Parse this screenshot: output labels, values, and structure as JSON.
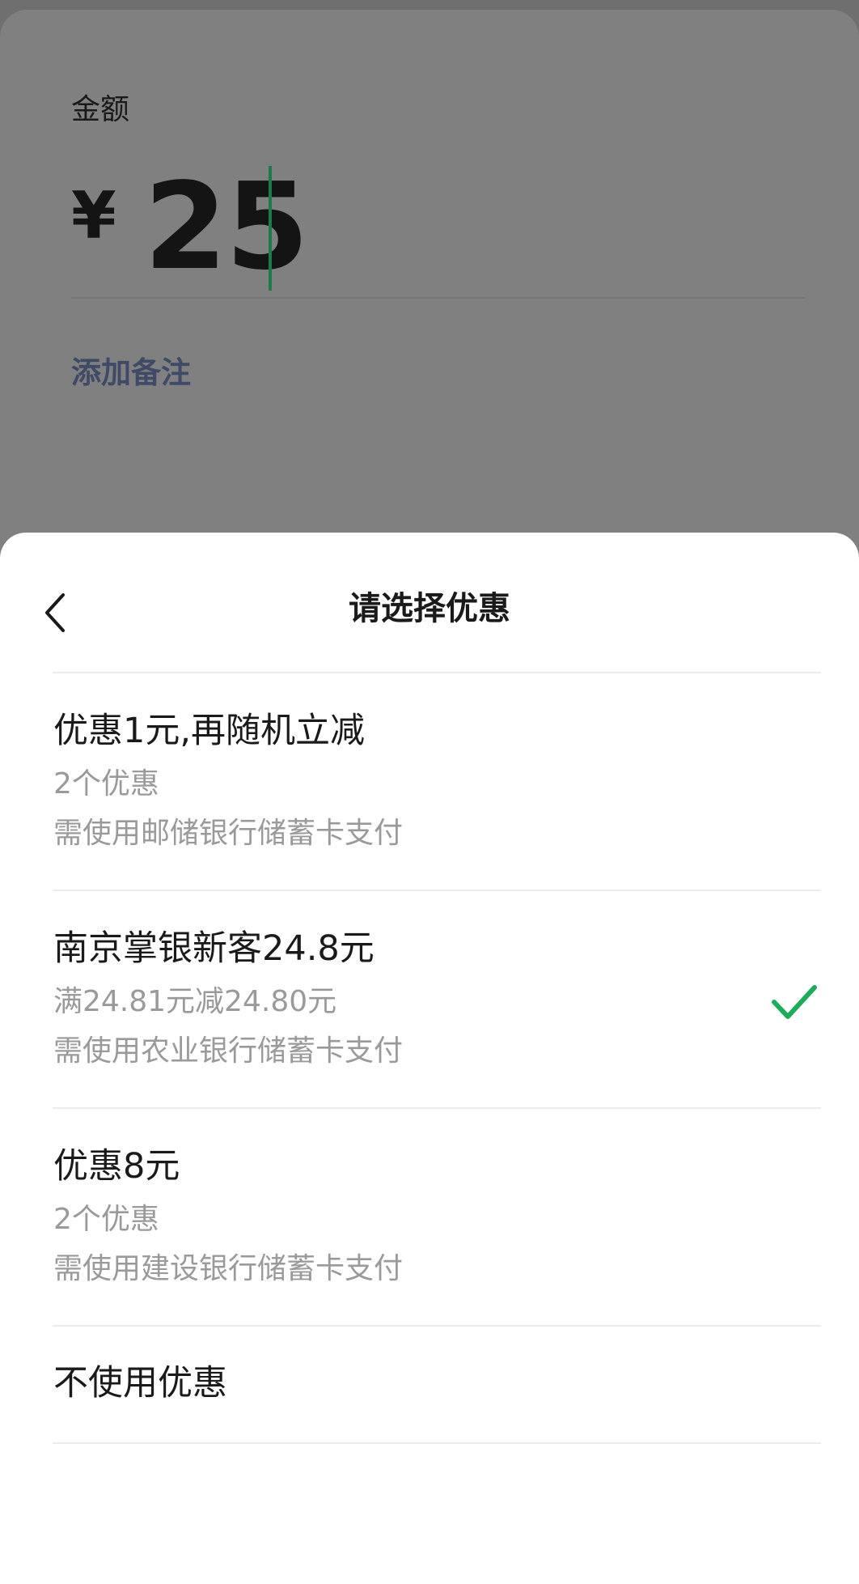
{
  "payment": {
    "amount_label": "金额",
    "currency": "¥",
    "amount": "25",
    "add_note": "添加备注"
  },
  "sheet": {
    "title": "请选择优惠",
    "options": [
      {
        "title": "优惠1元,再随机立减",
        "line1": "2个优惠",
        "line2": "需使用邮储银行储蓄卡支付",
        "selected": false
      },
      {
        "title": "南京掌银新客24.8元",
        "line1": "满24.81元减24.80元",
        "line2": "需使用农业银行储蓄卡支付",
        "selected": true
      },
      {
        "title": "优惠8元",
        "line1": "2个优惠",
        "line2": "需使用建设银行储蓄卡支付",
        "selected": false
      },
      {
        "title": "不使用优惠",
        "selected": false
      }
    ]
  },
  "icons": {
    "back": "chevron-left-icon",
    "selected": "checkmark-icon"
  },
  "colors": {
    "accent_green": "#1aad5a",
    "link_blue": "#3e4a66",
    "caret_green": "#1f7a4a"
  }
}
